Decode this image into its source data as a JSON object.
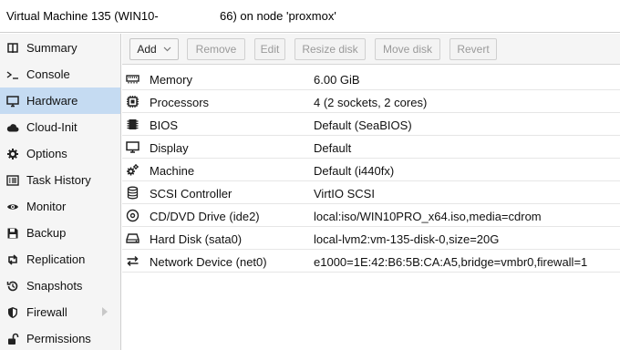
{
  "window": {
    "title_left": "Virtual Machine 135 (WIN10-",
    "title_right": "66) on node 'proxmox'"
  },
  "sidebar": {
    "items": [
      {
        "label": "Summary",
        "icon": "book-icon"
      },
      {
        "label": "Console",
        "icon": "terminal-icon"
      },
      {
        "label": "Hardware",
        "icon": "desktop-icon",
        "selected": true
      },
      {
        "label": "Cloud-Init",
        "icon": "cloud-icon"
      },
      {
        "label": "Options",
        "icon": "gear-icon"
      },
      {
        "label": "Task History",
        "icon": "list-icon"
      },
      {
        "label": "Monitor",
        "icon": "eye-icon"
      },
      {
        "label": "Backup",
        "icon": "floppy-icon"
      },
      {
        "label": "Replication",
        "icon": "retweet-icon"
      },
      {
        "label": "Snapshots",
        "icon": "history-icon"
      },
      {
        "label": "Firewall",
        "icon": "shield-icon",
        "has_submenu": true
      },
      {
        "label": "Permissions",
        "icon": "unlock-icon"
      }
    ]
  },
  "toolbar": {
    "add_label": "Add",
    "remove_label": "Remove",
    "edit_label": "Edit",
    "resize_label": "Resize disk",
    "move_label": "Move disk",
    "revert_label": "Revert"
  },
  "hardware": {
    "rows": [
      {
        "name": "Memory",
        "value": "6.00 GiB",
        "icon": "memory-icon"
      },
      {
        "name": "Processors",
        "value": "4 (2 sockets, 2 cores)",
        "icon": "cpu-icon"
      },
      {
        "name": "BIOS",
        "value": "Default (SeaBIOS)",
        "icon": "chip-icon"
      },
      {
        "name": "Display",
        "value": "Default",
        "icon": "monitor-icon"
      },
      {
        "name": "Machine",
        "value": "Default (i440fx)",
        "icon": "cogs-icon"
      },
      {
        "name": "SCSI Controller",
        "value": "VirtIO SCSI",
        "icon": "database-icon"
      },
      {
        "name": "CD/DVD Drive (ide2)",
        "value": "local:iso/WIN10PRO_x64.iso,media=cdrom",
        "icon": "disc-icon"
      },
      {
        "name": "Hard Disk (sata0)",
        "value": "local-lvm2:vm-135-disk-0,size=20G",
        "icon": "harddisk-icon"
      },
      {
        "name": "Network Device (net0)",
        "value": "e1000=1E:42:B6:5B:CA:A5,bridge=vmbr0,firewall=1",
        "icon": "exchange-icon"
      }
    ]
  }
}
